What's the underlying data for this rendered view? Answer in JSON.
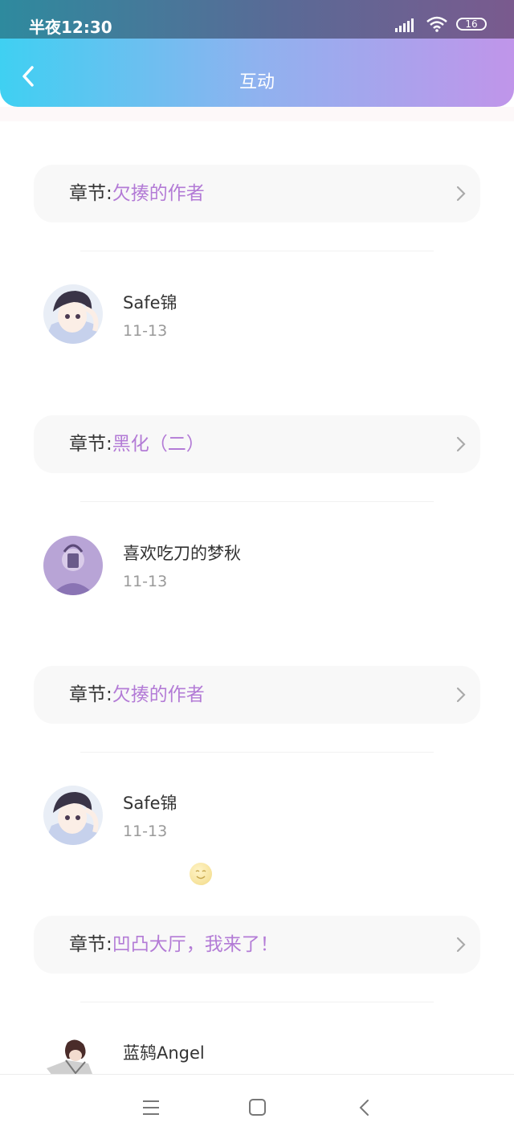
{
  "status_bar": {
    "time": "半夜12:30",
    "battery": "16"
  },
  "header": {
    "title": "互动"
  },
  "chapter_prefix": "章节:",
  "feed": [
    {
      "chapter_title": "欠揍的作者",
      "user_name": "Safe锦",
      "date": "11-13"
    },
    {
      "chapter_title": "黑化（二）",
      "user_name": "喜欢吃刀的梦秋",
      "date": "11-13"
    },
    {
      "chapter_title": "欠揍的作者",
      "user_name": "Safe锦",
      "date": "11-13"
    },
    {
      "chapter_title": "凹凸大厅，我来了！",
      "user_name": "蓝鸫Angel",
      "date": ""
    }
  ],
  "icons": {
    "back": "chevron-left-icon",
    "chevron": "chevron-right-icon",
    "menu": "menu-icon",
    "home": "home-icon",
    "nav_back": "back-icon"
  },
  "colors": {
    "accent_title": "#b37bd6",
    "header_gradient_start": "#3fd0f2",
    "header_gradient_end": "#c095ea"
  }
}
